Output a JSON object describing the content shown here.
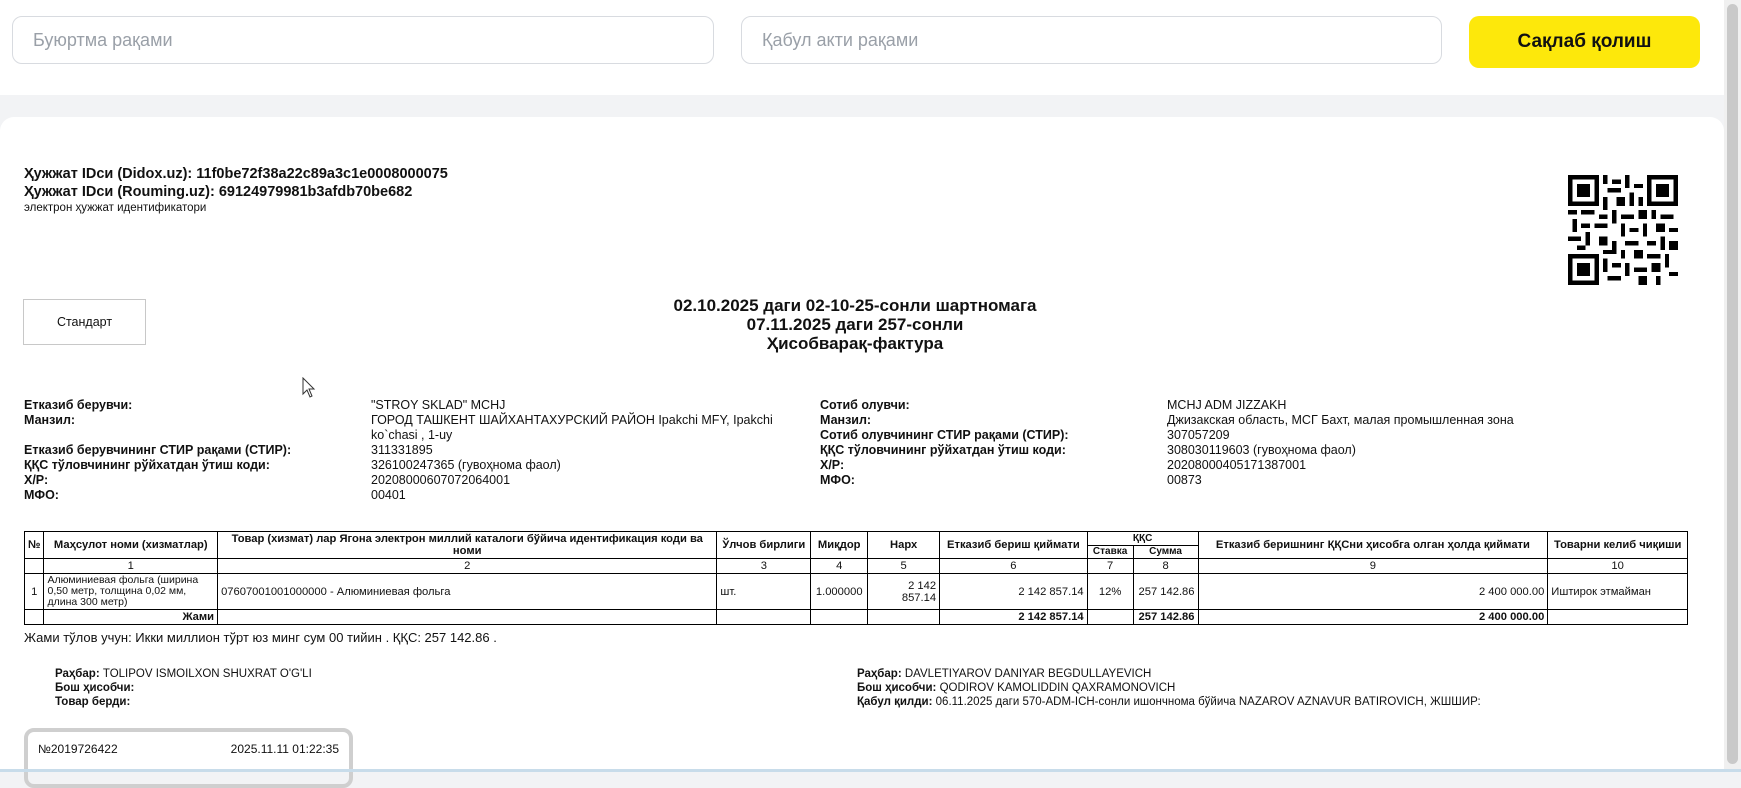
{
  "form": {
    "order_placeholder": "Буюртма рақами",
    "act_placeholder": "Қабул акти рақами",
    "save_label": "Сақлаб қолиш"
  },
  "doc": {
    "id_didox": "Ҳужжат IDси (Didox.uz): 11f0be72f38a22c89a3c1e0008000075",
    "id_rouming": "Ҳужжат IDси (Rouming.uz): 69124979981b3afdb70be682",
    "id_note": "электрон ҳужжат идентификатори",
    "standard_label": "Стандарт",
    "title_line1": "02.10.2025 даги 02-10-25-сонли шартномага",
    "title_line2": "07.11.2025 даги 257-сонли",
    "title_line3": "Ҳисобварақ-фактура"
  },
  "seller": {
    "labels": [
      "Етказиб берувчи:",
      "Манзил:",
      "Етказиб берувчининг СТИР рақами (СТИР):",
      "ҚҚС тўловчининг рўйхатдан ўтиш коди:",
      "Х/Р:",
      "МФО:"
    ],
    "name": "\"STROY SKLAD\" MCHJ",
    "address_line1": "ГОРОД ТАШКЕНТ ШАЙХАНТАХУРСКИЙ РАЙОН Ipakchi MFY, Ipakchi",
    "address_line2": "ko`chasi , 1-uy",
    "stir": "311331895",
    "vat_code": "326100247365 (гувоҳнома фаол)",
    "account": "20208000607072064001",
    "mfo": "00401"
  },
  "buyer": {
    "labels": [
      "Сотиб олувчи:",
      "Манзил:",
      "Сотиб олувчининг СТИР рақами (СТИР):",
      "ҚҚС тўловчининг рўйхатдан ўтиш коди:",
      "Х/Р:",
      "МФО:"
    ],
    "name": "MCHJ ADM JIZZAKH",
    "address": "Джизакская область, МСГ Бахт, малая промышленная зона",
    "stir": "307057209",
    "vat_code": "308030119603 (гувоҳнома фаол)",
    "account": "20208000405171387001",
    "mfo": "00873"
  },
  "table": {
    "headers": {
      "num": "№",
      "name": "Маҳсулот номи (хизматлар)",
      "code": "Товар (хизмат) лар Ягона электрон миллий каталоги бўйича идентификация коди ва номи",
      "unit": "Ўлчов бирлиги",
      "qty": "Миқдор",
      "price": "Нарх",
      "delivery_cost": "Етказиб бериш қиймати",
      "vat": "ҚҚС",
      "vat_rate": "Ставка",
      "vat_sum": "Сумма",
      "total_with_vat": "Етказиб беришнинг ҚҚСни ҳисобга олган ҳолда қиймати",
      "origin": "Товарни келиб чиқиши"
    },
    "col_numbers": [
      "1",
      "2",
      "3",
      "4",
      "5",
      "6",
      "7",
      "8",
      "9",
      "10"
    ],
    "row": {
      "num": "1",
      "name": "Алюминиевая фольга (ширина 0,50 метр, толщина 0,02 мм, длина 300 метр)",
      "code": "07607001001000000 - Алюминиевая фольга",
      "unit": "шт.",
      "qty": "1.000000",
      "price": "2 142 857.14",
      "delivery_cost": "2 142 857.14",
      "vat_rate": "12%",
      "vat_sum": "257 142.86",
      "total_with_vat": "2 400 000.00",
      "origin": "Иштирок этмайман"
    },
    "total": {
      "label": "Жами",
      "delivery_cost": "2 142 857.14",
      "vat_sum": "257 142.86",
      "total_with_vat": "2 400 000.00"
    }
  },
  "sum_line": "Жами тўлов учун: Икки миллион тўрт юз минг сум 00 тийин . ҚҚС: 257 142.86 .",
  "signs_left": {
    "head_label": "Раҳбар:",
    "head_value": "TOLIPOV ISMOILXON SHUXRAT O'G'LI",
    "accountant_label": "Бош ҳисобчи:",
    "accountant_value": "",
    "released_label": "Товар берди:",
    "released_value": ""
  },
  "signs_right": {
    "head_label": "Раҳбар:",
    "head_value": "DAVLETIYAROV DANIYAR BEGDULLAYEVICH",
    "accountant_label": "Бош ҳисобчи:",
    "accountant_value": "QODIROV KAMOLIDDIN QAXRAMONOVICH",
    "received_label": "Қабул қилди:",
    "received_value": "06.11.2025 даги 570-ADM-ICH-сонли ишончнома бўйича NAZAROV AZNAVUR BATIROVICH, ЖШШИР:"
  },
  "stamp": {
    "number": "№2019726422",
    "datetime": "2025.11.11 01:22:35"
  },
  "icons": {
    "qr": "qr-code-icon",
    "cursor": "mouse-cursor-icon"
  },
  "colors": {
    "accent": "#fde80b",
    "page_bg": "#f2f3f5"
  }
}
